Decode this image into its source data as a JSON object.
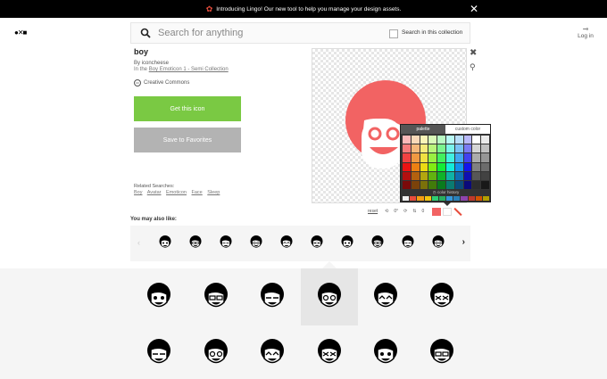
{
  "banner": {
    "text": "Introducing Lingo! Our new tool to help you manage your design assets."
  },
  "search": {
    "placeholder": "Search for anything",
    "collection_label": "Search in this collection"
  },
  "header": {
    "login_label": "Log in"
  },
  "icon_detail": {
    "title": "boy",
    "author_line": "By iconcheese",
    "in_prefix": "In the",
    "collection_name": "Boy Emoticon 1 - Semi Collection",
    "license": "Creative Commons"
  },
  "actions": {
    "get_icon": "Get this icon",
    "save_favorites": "Save to Favorites"
  },
  "related": {
    "label": "Related Searches:",
    "items": [
      "Boy",
      "Avatar",
      "Emoticon",
      "Face",
      "Sleep"
    ]
  },
  "toolbar": {
    "reset": "reset",
    "rotate": "0°",
    "flip": "0"
  },
  "palette": {
    "tab_palette": "palette",
    "tab_custom": "custom color",
    "history_label": "color history"
  },
  "also_like": {
    "label": "You may also like:"
  },
  "colors": {
    "accent_green": "#7ac943",
    "selected_icon": "#f26363"
  }
}
